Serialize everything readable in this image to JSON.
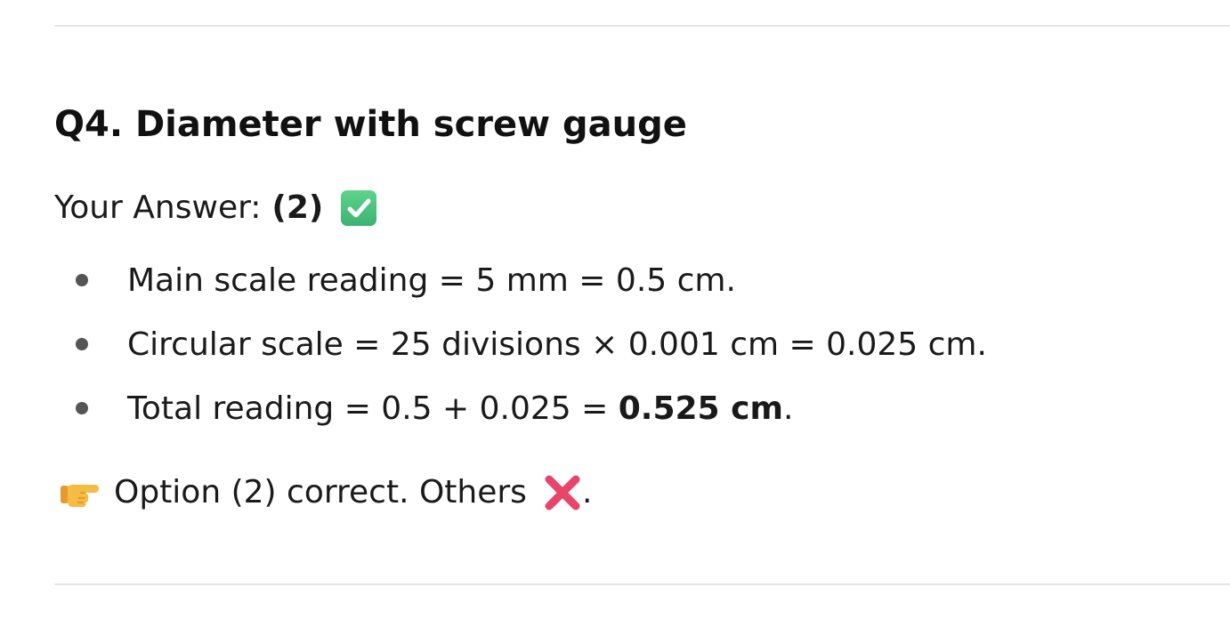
{
  "question": {
    "title": "Q4. Diameter with screw gauge"
  },
  "answer": {
    "label": "Your Answer:",
    "value": "(2)",
    "status_icon": "check-mark-button-icon"
  },
  "points": [
    {
      "text": "Main scale reading = 5 mm = 0.5 cm.",
      "bold": "",
      "after": ""
    },
    {
      "text": "Circular scale = 25 divisions × 0.001 cm = 0.025 cm.",
      "bold": "",
      "after": ""
    },
    {
      "text": "Total reading = 0.5 + 0.025 = ",
      "bold": "0.525 cm",
      "after": "."
    }
  ],
  "conclusion": {
    "lead_icon": "backhand-index-pointing-right-icon",
    "text": "Option (2) correct. Others",
    "trail_icon": "cross-mark-icon",
    "end": "."
  },
  "colors": {
    "check": "#3cb371",
    "cross": "#e8456b",
    "hand": "#f4b73f",
    "rule": "#e6e6e6"
  }
}
